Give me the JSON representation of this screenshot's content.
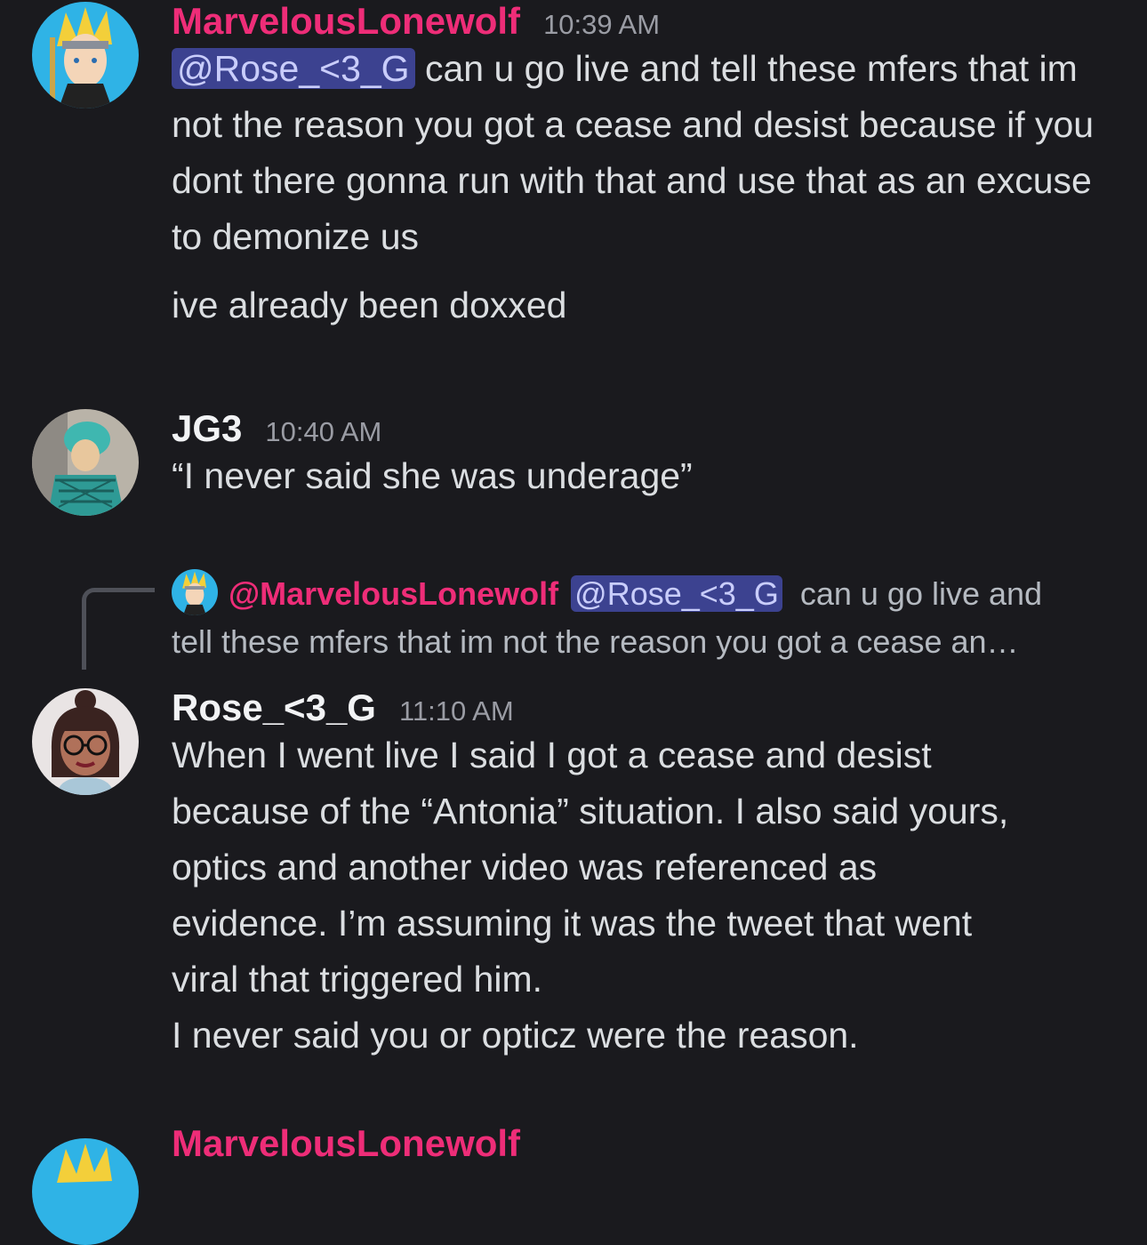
{
  "messages": [
    {
      "author": "MarvelousLonewolf",
      "time": "10:39 AM",
      "mention": "@Rose_<3_G",
      "text_after_mention": " can u go live and tell these mfers that im not the reason you got a cease and desist because if you dont there gonna run with that and use that as an excuse to demonize us",
      "followup": "ive already been doxxed"
    },
    {
      "author": "JG3",
      "time": "10:40 AM",
      "text": "“I never said she was underage”"
    },
    {
      "reply_to": {
        "author": "@MarvelousLonewolf",
        "mention": "@Rose_<3_G",
        "preview_line1": "can u go live and",
        "preview_line2": "tell these mfers that im not the reason you got a cease an…"
      },
      "author": "Rose_<3_G",
      "time": "11:10 AM",
      "text": "When I went live I said I got a cease and desist\nbecause of the “Antonia” situation. I also said yours,\noptics and another video was referenced as\nevidence. I’m assuming it was the tweet that went\nviral that triggered him.\nI never said you or opticz were the reason."
    },
    {
      "author": "MarvelousLonewolf"
    }
  ]
}
